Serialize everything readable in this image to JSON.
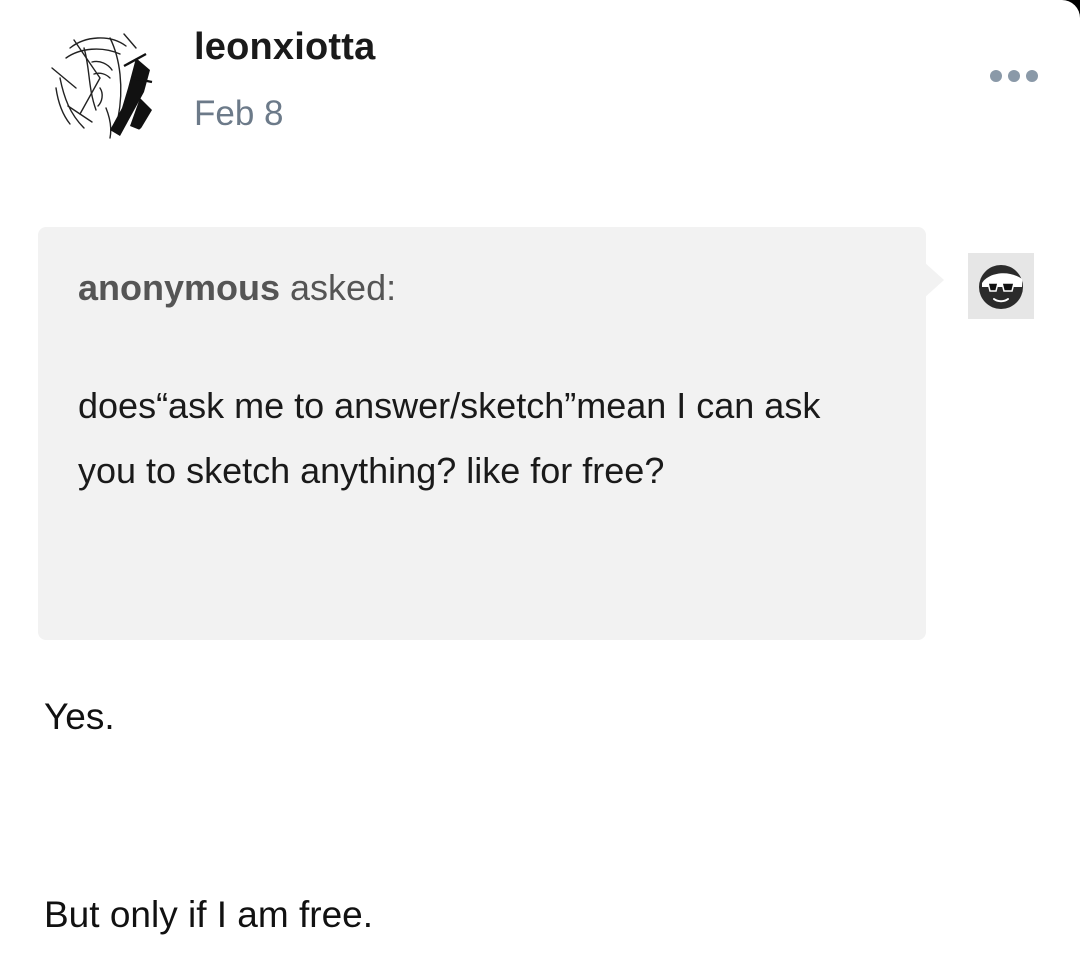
{
  "post": {
    "author": {
      "username": "leonxiotta",
      "avatar_icon": "sketch-portrait-avatar"
    },
    "date": "Feb 8",
    "menu_icon": "more-options-icon",
    "ask": {
      "asker_name": "anonymous",
      "asked_label": " asked:",
      "question": "does“ask me to answer/sketch”mean I can ask you to sketch anything? like for free?",
      "asker_avatar_icon": "sunglasses-face-avatar",
      "background_color": "#f2f2f2"
    },
    "answer": {
      "paragraphs": [
        "Yes.",
        "But only if I am free."
      ]
    }
  },
  "colors": {
    "page_background": "#ffffff",
    "date_text": "#6c7a89",
    "menu_dots": "#8a99a8",
    "outer_frame": "#000000"
  }
}
